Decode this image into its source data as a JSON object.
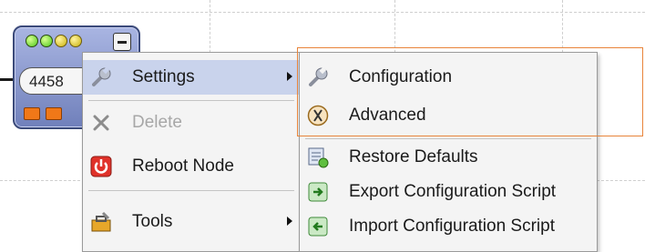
{
  "node": {
    "id_text": "4458"
  },
  "context_menu": {
    "items": [
      {
        "label": "Settings",
        "icon": "wrench-icon",
        "enabled": true,
        "has_submenu": true
      },
      {
        "label": "Delete",
        "icon": "delete-x-icon",
        "enabled": false
      },
      {
        "label": "Reboot Node",
        "icon": "power-icon",
        "enabled": true
      },
      {
        "label": "Tools",
        "icon": "toolbox-icon",
        "enabled": true,
        "has_submenu": true
      }
    ]
  },
  "settings_submenu": {
    "items": [
      {
        "label": "Configuration",
        "icon": "wrench-icon"
      },
      {
        "label": "Advanced",
        "icon": "advanced-tools-icon"
      },
      {
        "label": "Restore Defaults",
        "icon": "restore-icon"
      },
      {
        "label": "Export Configuration Script",
        "icon": "export-arrow-icon"
      },
      {
        "label": "Import Configuration Script",
        "icon": "import-arrow-icon"
      }
    ]
  },
  "colors": {
    "accent_highlight": "#e8843a",
    "menu_background": "#f4f4f4",
    "selected_item": "#c9d3ec",
    "disabled_text": "#a7a7a7"
  }
}
